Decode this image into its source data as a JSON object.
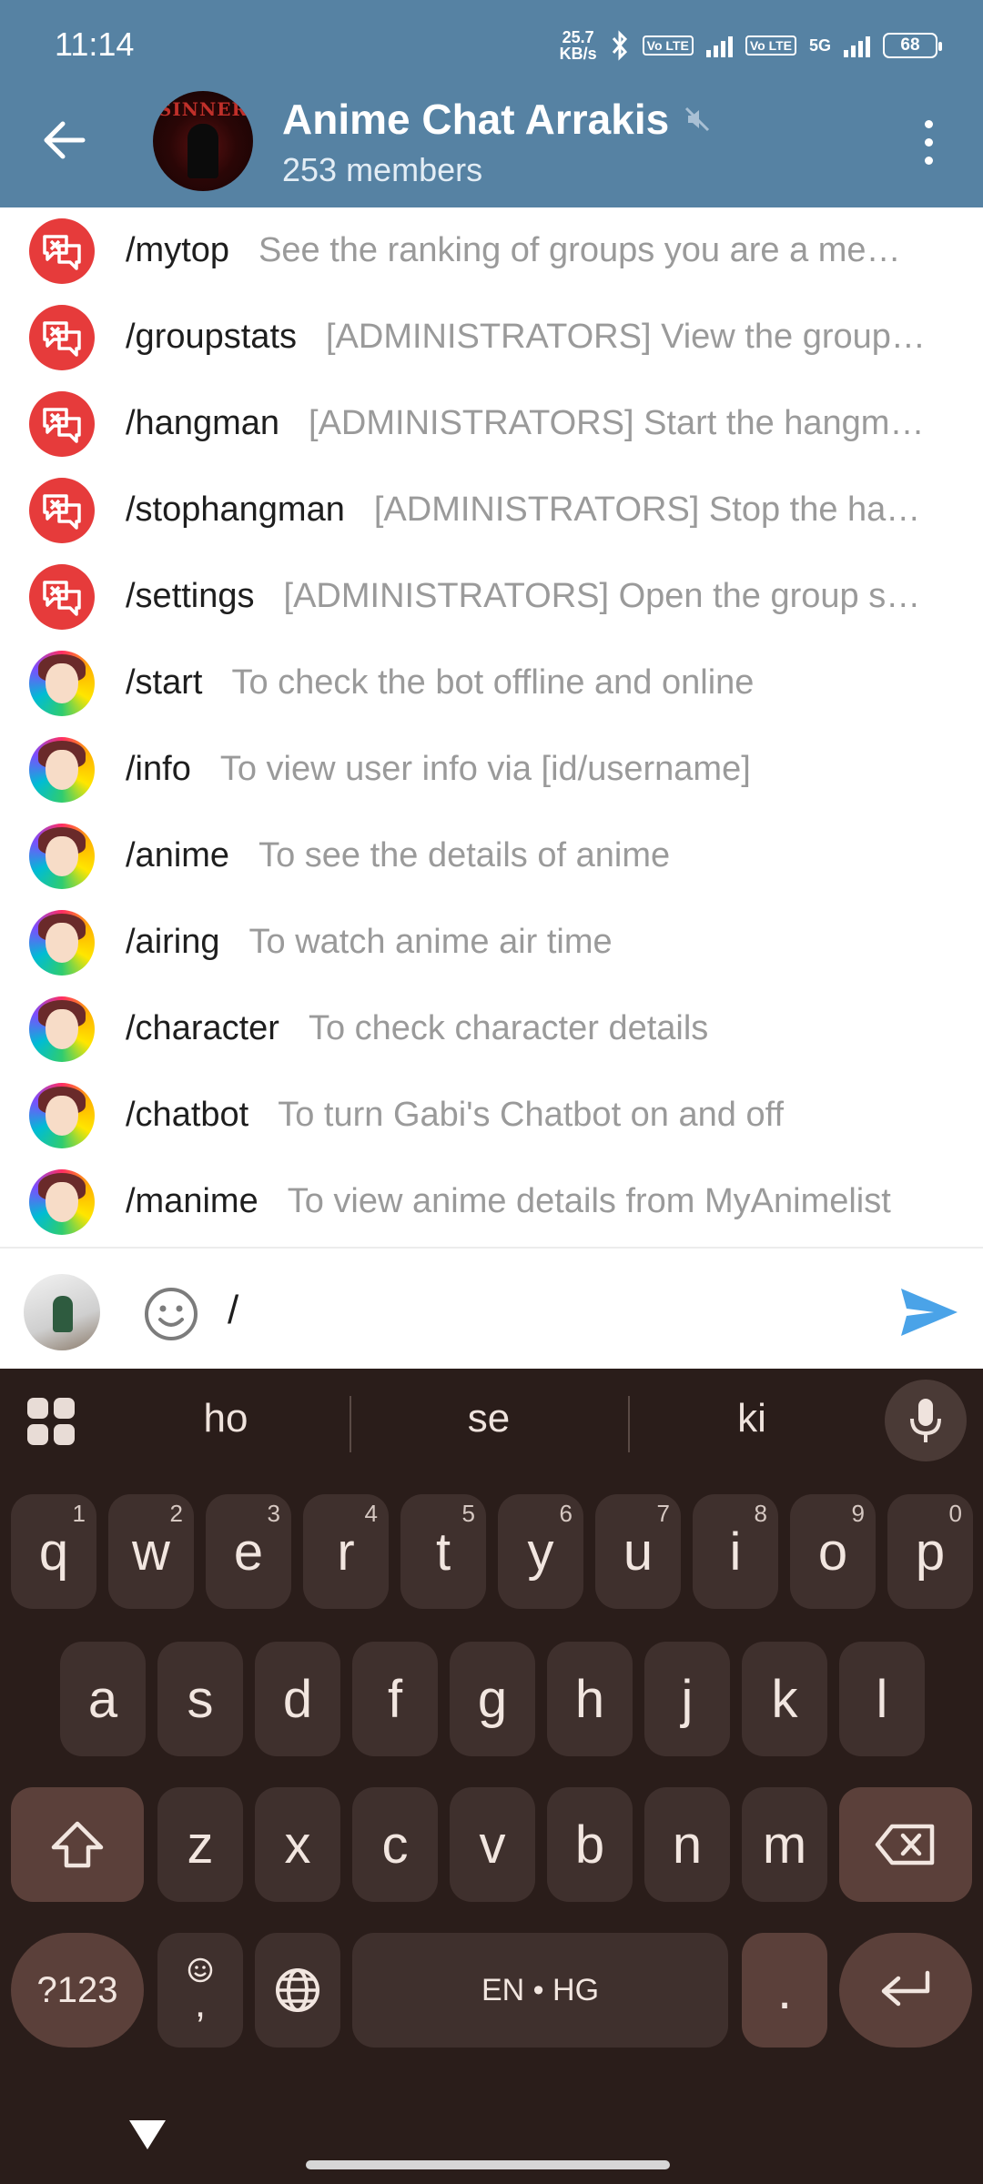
{
  "status_bar": {
    "time": "11:14",
    "net_speed_value": "25.7",
    "net_speed_unit": "KB/s",
    "volte1": "Vo LTE",
    "volte2": "Vo LTE",
    "network": "5G",
    "battery": "68"
  },
  "header": {
    "title": "Anime Chat Arrakis",
    "subtitle": "253 members",
    "avatar_text": "SINNER",
    "muted": true
  },
  "commands": [
    {
      "name": "/mytop",
      "desc": "See the ranking of groups you are a me…",
      "bot": "red"
    },
    {
      "name": "/groupstats",
      "desc": "[ADMINISTRATORS] View the group…",
      "bot": "red"
    },
    {
      "name": "/hangman",
      "desc": "[ADMINISTRATORS] Start the hangm…",
      "bot": "red"
    },
    {
      "name": "/stophangman",
      "desc": "[ADMINISTRATORS] Stop the ha…",
      "bot": "red"
    },
    {
      "name": "/settings",
      "desc": "[ADMINISTRATORS] Open the group s…",
      "bot": "red"
    },
    {
      "name": "/start",
      "desc": "To check the bot offline and online",
      "bot": "anime"
    },
    {
      "name": "/info",
      "desc": "To view user info via [id/username]",
      "bot": "anime"
    },
    {
      "name": "/anime",
      "desc": "To see the details of anime",
      "bot": "anime"
    },
    {
      "name": "/airing",
      "desc": "To watch anime air time",
      "bot": "anime"
    },
    {
      "name": "/character",
      "desc": "To check character details",
      "bot": "anime"
    },
    {
      "name": "/chatbot",
      "desc": "To turn Gabi's Chatbot on and off",
      "bot": "anime"
    },
    {
      "name": "/manime",
      "desc": "To view anime details from MyAnimelist",
      "bot": "anime"
    }
  ],
  "input": {
    "value": "/"
  },
  "keyboard": {
    "suggestions": [
      "ho",
      "se",
      "ki"
    ],
    "row1": [
      {
        "k": "q",
        "h": "1"
      },
      {
        "k": "w",
        "h": "2"
      },
      {
        "k": "e",
        "h": "3"
      },
      {
        "k": "r",
        "h": "4"
      },
      {
        "k": "t",
        "h": "5"
      },
      {
        "k": "y",
        "h": "6"
      },
      {
        "k": "u",
        "h": "7"
      },
      {
        "k": "i",
        "h": "8"
      },
      {
        "k": "o",
        "h": "9"
      },
      {
        "k": "p",
        "h": "0"
      }
    ],
    "row2": [
      "a",
      "s",
      "d",
      "f",
      "g",
      "h",
      "j",
      "k",
      "l"
    ],
    "row3": [
      "z",
      "x",
      "c",
      "v",
      "b",
      "n",
      "m"
    ],
    "symbols_label": "?123",
    "comma_label": ",",
    "space_label": "EN • HG",
    "period_label": "."
  },
  "colors": {
    "header": "#5682a3",
    "keyboard_bg": "#2a1d1a",
    "key_bg": "#3f302d",
    "key_special": "#5b403a",
    "bot_red": "#e63b3b",
    "send": "#4aa3e8"
  }
}
